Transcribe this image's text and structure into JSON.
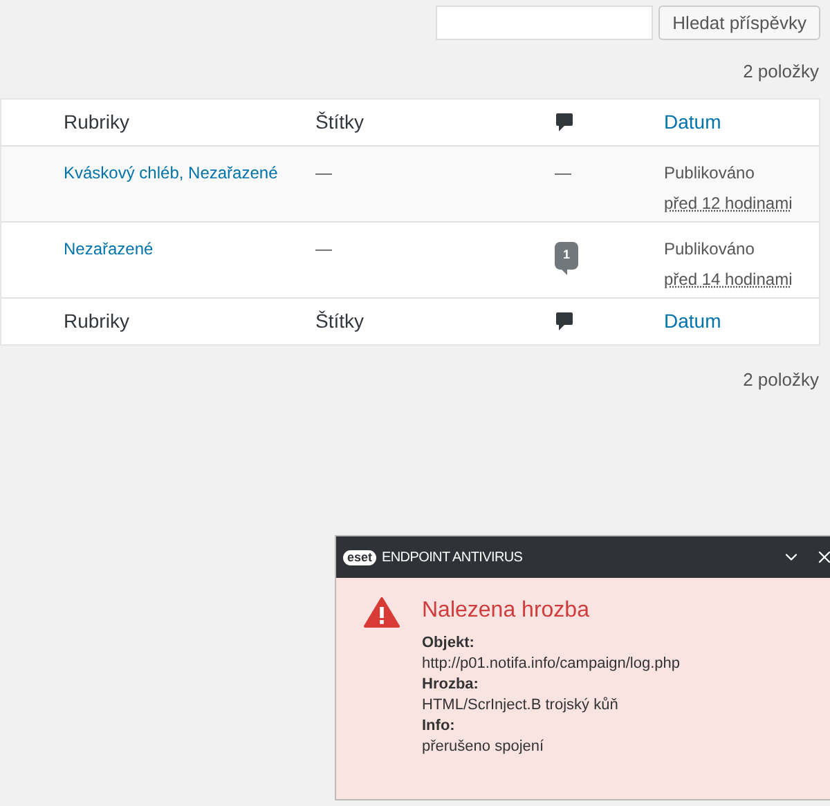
{
  "search": {
    "button": "Hledat příspěvky"
  },
  "item_count_top": "2 položky",
  "table": {
    "columns": [
      "Rubriky",
      "Štítky",
      "Datum"
    ],
    "rows": [
      {
        "categories": "Kváskový chléb, Nezařazené",
        "tags": "—",
        "comments": "—",
        "kind": "none",
        "status": "Publikováno",
        "date": "před 12 hodinami"
      },
      {
        "categories": "Nezařazené",
        "tags": "—",
        "comments": "1",
        "kind": "count",
        "status": "Publikováno",
        "date": "před 14 hodinami"
      }
    ],
    "footer_columns": [
      "Rubriky",
      "Štítky",
      "Datum"
    ]
  },
  "item_count_bottom": "2 položky",
  "notification": {
    "logo": "eset",
    "title": "ENDPOINT ANTIVIRUS",
    "heading": "Nalezena hrozba",
    "fields": [
      {
        "label": "Objekt:",
        "value": "http://p01.notifa.info/campaign/log.php"
      },
      {
        "label": "Hrozba:",
        "value": "HTML/ScrInject.B trojský kůň"
      },
      {
        "label": "Info:",
        "value": "přerušeno spojení"
      }
    ]
  }
}
